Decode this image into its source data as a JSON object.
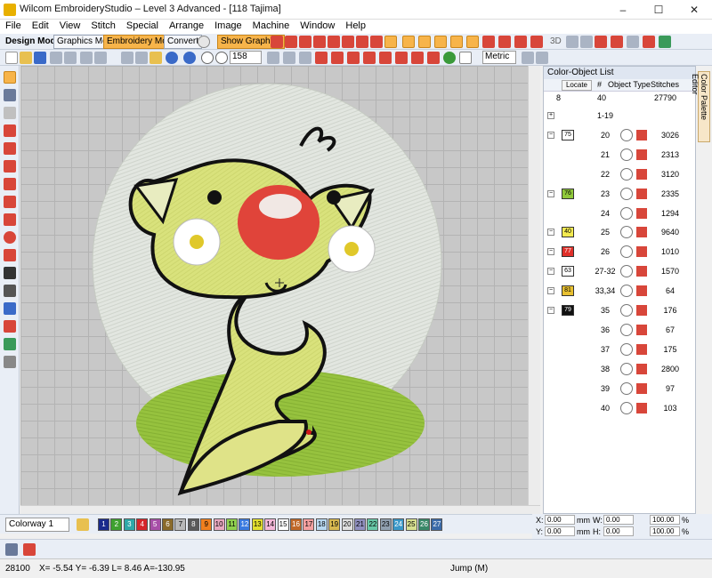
{
  "window": {
    "title": "Wilcom EmbroideryStudio – Level 3 Advanced - [118      Tajima]"
  },
  "menu": [
    "File",
    "Edit",
    "View",
    "Stitch",
    "Special",
    "Arrange",
    "Image",
    "Machine",
    "Window",
    "Help"
  ],
  "toolbar1": {
    "design_mode_label": "Design Mode:",
    "graphics_mode": "Graphics Mode",
    "embroidery_mode": "Embroidery Mode",
    "convert": "Convert",
    "show_graphics": "Show Graphics",
    "threed_label": "3D"
  },
  "toolbar2": {
    "zoom_value": "158",
    "units": "Metric"
  },
  "panel": {
    "title": "Color-Object List",
    "locate": "Locate",
    "col_num": "#",
    "col_object_type": "Object Type",
    "col_stitches": "Stitches",
    "summary": {
      "count": "8",
      "objects": "40",
      "stitches": "27790"
    },
    "rows": [
      {
        "color": "",
        "num": "1-19",
        "stitches": ""
      },
      {
        "color": "75",
        "num": "20",
        "stitches": "3026"
      },
      {
        "color": "",
        "num": "21",
        "stitches": "2313"
      },
      {
        "color": "",
        "num": "22",
        "stitches": "3120"
      },
      {
        "color": "76",
        "num": "23",
        "stitches": "2335"
      },
      {
        "color": "",
        "num": "24",
        "stitches": "1294"
      },
      {
        "color": "40",
        "num": "25",
        "stitches": "9640"
      },
      {
        "color": "77",
        "num": "26",
        "stitches": "1010"
      },
      {
        "color": "63",
        "num": "27-32",
        "stitches": "1570"
      },
      {
        "color": "81",
        "num": "33,34",
        "stitches": "64"
      },
      {
        "color": "79",
        "num": "35",
        "stitches": "176"
      },
      {
        "color": "",
        "num": "36",
        "stitches": "67"
      },
      {
        "color": "",
        "num": "37",
        "stitches": "175"
      },
      {
        "color": "",
        "num": "38",
        "stitches": "2800"
      },
      {
        "color": "",
        "num": "39",
        "stitches": "97"
      },
      {
        "color": "",
        "num": "40",
        "stitches": "103"
      }
    ]
  },
  "side_tab": "Color Palette Editor",
  "colorway": {
    "selected": "Colorway 1",
    "swatches": [
      "1",
      "2",
      "3",
      "4",
      "5",
      "6",
      "7",
      "8",
      "9",
      "10",
      "11",
      "12",
      "13",
      "14",
      "15",
      "16",
      "17",
      "18",
      "19",
      "20",
      "21",
      "22",
      "23",
      "24",
      "25",
      "26",
      "27"
    ],
    "swatch_colors": [
      "#1a2a8c",
      "#3fa12f",
      "#2ea8a8",
      "#d6262a",
      "#a84fa8",
      "#8a6a2a",
      "#b8b8b8",
      "#5a5a5a",
      "#f07f1e",
      "#e8a8c0",
      "#8fd04f",
      "#3a7adf",
      "#e3df2e",
      "#f4b8d8",
      "#ffffff",
      "#c06828",
      "#f4a0a0",
      "#b8d8f0",
      "#d8b850",
      "#e0e0e0",
      "#9090c0",
      "#68c8a8",
      "#90a0b0",
      "#3a98c8",
      "#d8e090",
      "#388868",
      "#3a6aa8"
    ]
  },
  "coords": {
    "x_label": "X:",
    "x_val": "0.00",
    "w_label": "W:",
    "w_val": "0.00",
    "pct1": "100.00",
    "mm": "mm",
    "y_label": "Y:",
    "y_val": "0.00",
    "h_label": "H:",
    "h_val": "0.00",
    "pct2": "100.00",
    "pct_sign": "%"
  },
  "status": {
    "stitch_count": "28100",
    "coords_text": "X=  -5.54 Y=  -6.39 L=   8.46 A=-130.95",
    "mode": "Jump (M)"
  }
}
